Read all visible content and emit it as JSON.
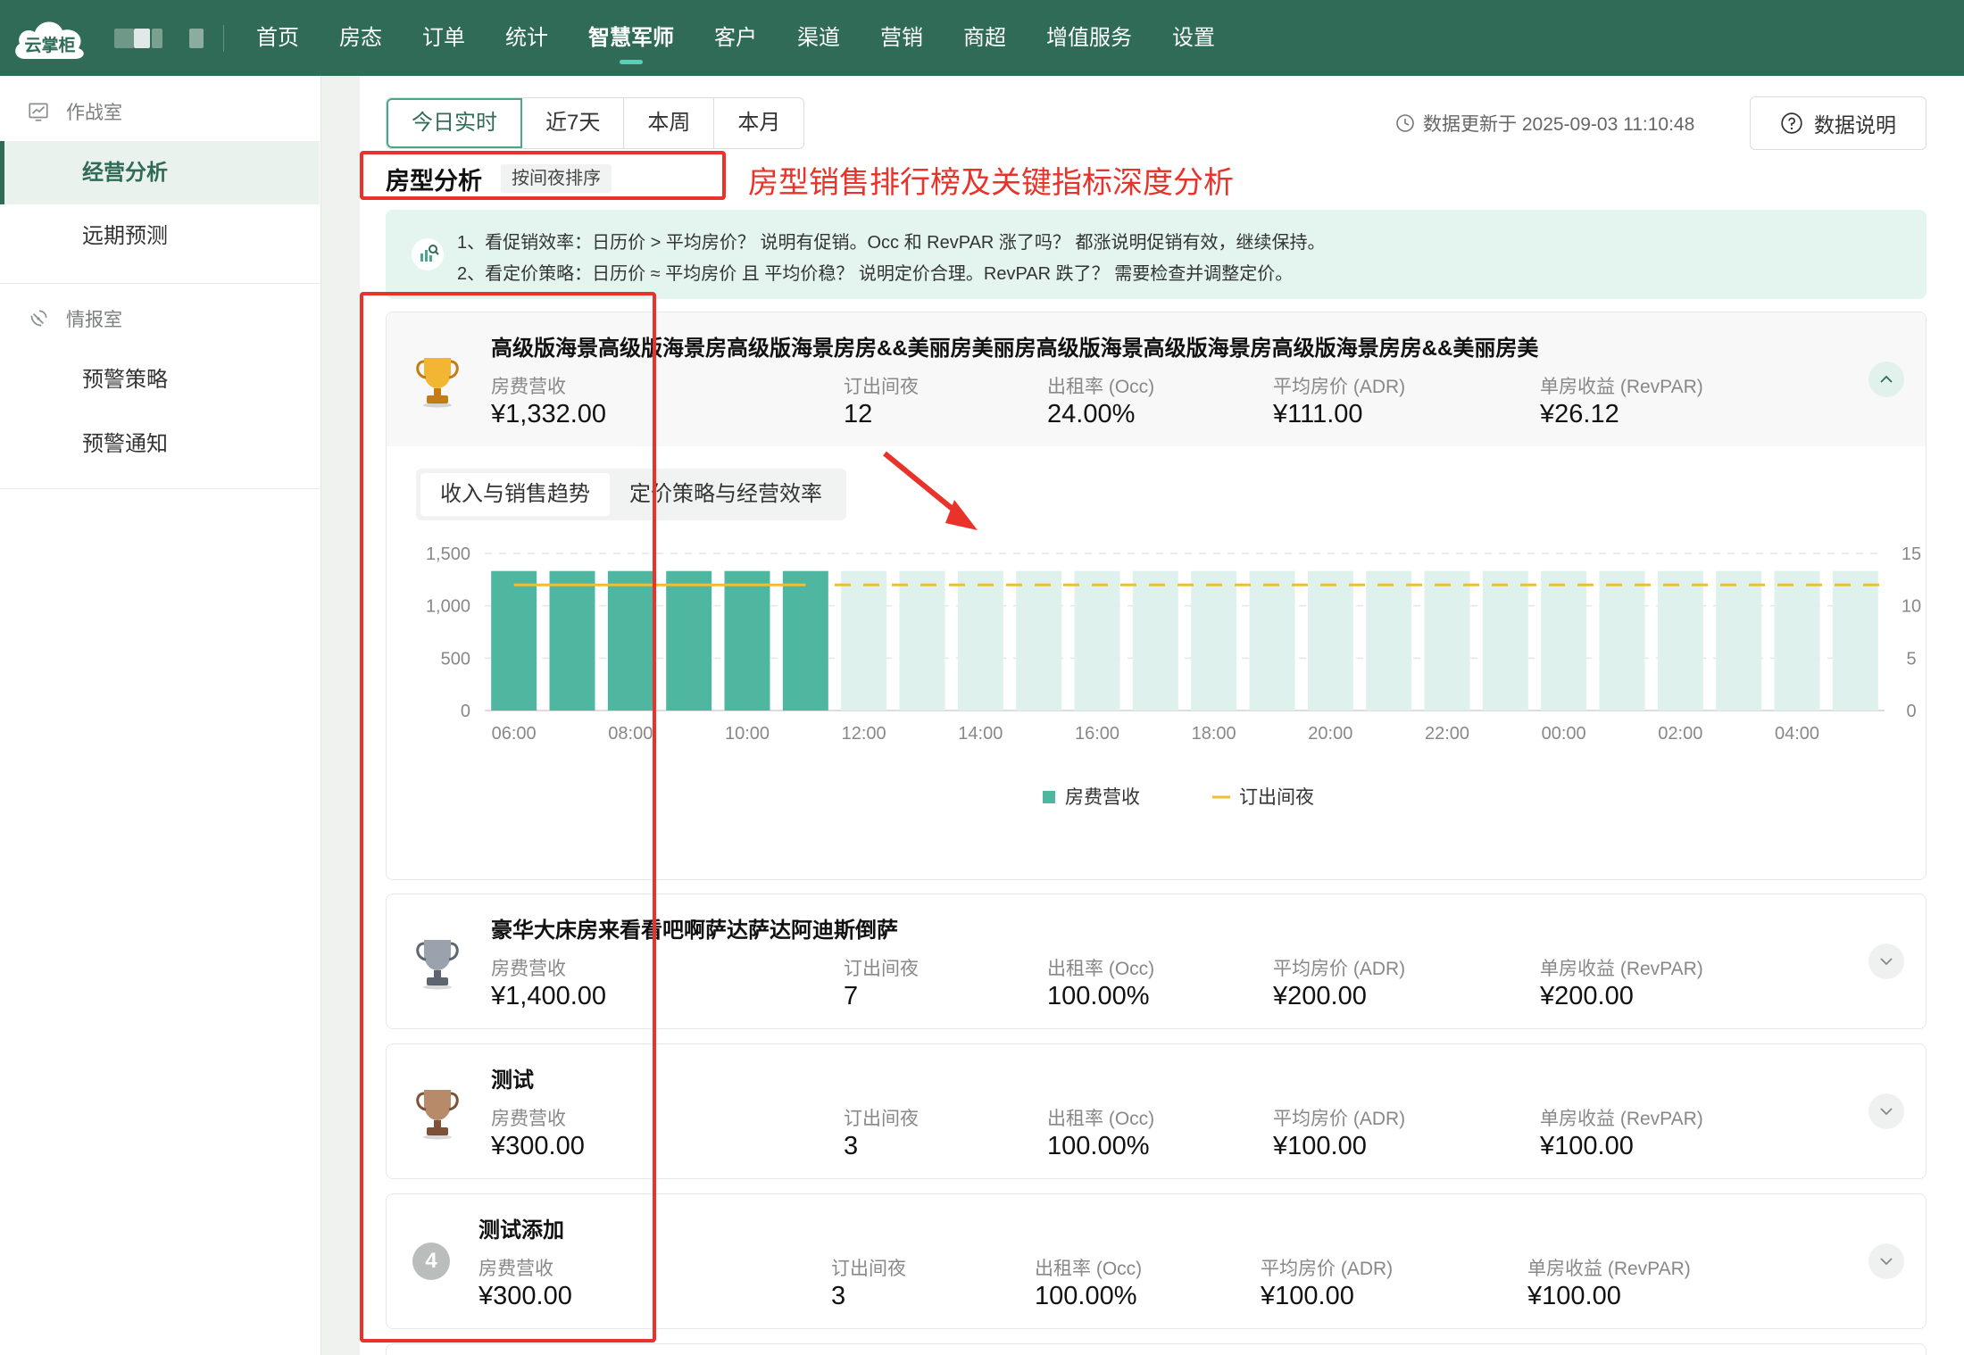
{
  "brand": {
    "logo_text": "云掌柜"
  },
  "nav": {
    "items": [
      "首页",
      "房态",
      "订单",
      "统计",
      "智慧军师",
      "客户",
      "渠道",
      "营销",
      "商超",
      "增值服务",
      "设置"
    ],
    "active_index": 4
  },
  "sidebar": {
    "groups": [
      {
        "label": "作战室",
        "items": [
          "经营分析",
          "远期预测"
        ]
      },
      {
        "label": "情报室",
        "items": [
          "预警策略",
          "预警通知"
        ]
      }
    ],
    "active_item": "经营分析"
  },
  "toolbar": {
    "tabs": [
      "今日实时",
      "近7天",
      "本周",
      "本月"
    ],
    "active_tab": 0,
    "update_text": "数据更新于 2025-09-03 11:10:48",
    "help_label": "数据说明"
  },
  "section": {
    "title": "房型分析",
    "sort_tag": "按间夜排序",
    "annotation": "房型销售排行榜及关键指标深度分析"
  },
  "tips": {
    "line1": "1、看促销效率：日历价 > 平均房价？ 说明有促销。Occ 和 RevPAR 涨了吗？ 都涨说明促销有效，继续保持。",
    "line2": "2、看定价策略：日历价 ≈ 平均房价 且 平均价稳？ 说明定价合理。RevPAR 跌了？ 需要检查并调整定价。"
  },
  "metric_labels": [
    "房费营收",
    "订出间夜",
    "出租率 (Occ)",
    "平均房价 (ADR)",
    "单房收益 (RevPAR)"
  ],
  "rooms": [
    {
      "rank": 1,
      "name": "高级版海景高级版海景房高级版海景房房&&美丽房美丽房高级版海景高级版海景房高级版海景房房&&美丽房美",
      "revenue": "¥1,332.00",
      "nights": "12",
      "occ": "24.00%",
      "adr": "¥111.00",
      "revpar": "¥26.12",
      "expanded": true
    },
    {
      "rank": 2,
      "name": "豪华大床房来看看吧啊萨达萨达阿迪斯倒萨",
      "revenue": "¥1,400.00",
      "nights": "7",
      "occ": "100.00%",
      "adr": "¥200.00",
      "revpar": "¥200.00",
      "expanded": false
    },
    {
      "rank": 3,
      "name": "测试",
      "revenue": "¥300.00",
      "nights": "3",
      "occ": "100.00%",
      "adr": "¥100.00",
      "revpar": "¥100.00",
      "expanded": false
    },
    {
      "rank": 4,
      "name": "测试添加",
      "revenue": "¥300.00",
      "nights": "3",
      "occ": "100.00%",
      "adr": "¥100.00",
      "revpar": "¥100.00",
      "expanded": false
    }
  ],
  "detail_tabs": [
    "收入与销售趋势",
    "定价策略与经营效率"
  ],
  "detail_active_tab": 0,
  "chart_data": {
    "type": "bar",
    "categories": [
      "06:00",
      "07:00",
      "08:00",
      "09:00",
      "10:00",
      "11:00",
      "12:00",
      "13:00",
      "14:00",
      "15:00",
      "16:00",
      "17:00",
      "18:00",
      "19:00",
      "20:00",
      "21:00",
      "22:00",
      "23:00",
      "00:00",
      "01:00",
      "02:00",
      "03:00",
      "04:00",
      "05:00"
    ],
    "x_tick_labels": [
      "06:00",
      "08:00",
      "10:00",
      "12:00",
      "14:00",
      "16:00",
      "18:00",
      "20:00",
      "22:00",
      "00:00",
      "02:00",
      "04:00"
    ],
    "series": [
      {
        "name": "房费营收",
        "type": "bar",
        "axis": "left",
        "color": "#4fb6a0",
        "values": [
          1332,
          1332,
          1332,
          1332,
          1332,
          1332,
          null,
          null,
          null,
          null,
          null,
          null,
          null,
          null,
          null,
          null,
          null,
          null,
          null,
          null,
          null,
          null,
          null,
          null
        ]
      },
      {
        "name": "订出间夜",
        "type": "line",
        "axis": "right",
        "color": "#f0bd36",
        "values": [
          12,
          12,
          12,
          12,
          12,
          12,
          null,
          null,
          null,
          null,
          null,
          null,
          null,
          null,
          null,
          null,
          null,
          null,
          null,
          null,
          null,
          null,
          null,
          null
        ]
      }
    ],
    "forecast": {
      "from_index": 6,
      "bar_color": "#dff1ec",
      "bar_value": 1332,
      "line_value": 12,
      "line_style": "dashed"
    },
    "ylim_left": [
      0,
      1500
    ],
    "yticks_left": [
      "0",
      "500",
      "1,000",
      "1,500"
    ],
    "ylim_right": [
      0,
      15
    ],
    "yticks_right": [
      "0",
      "5",
      "10",
      "15"
    ],
    "grid": true,
    "legend_position": "bottom-center"
  }
}
